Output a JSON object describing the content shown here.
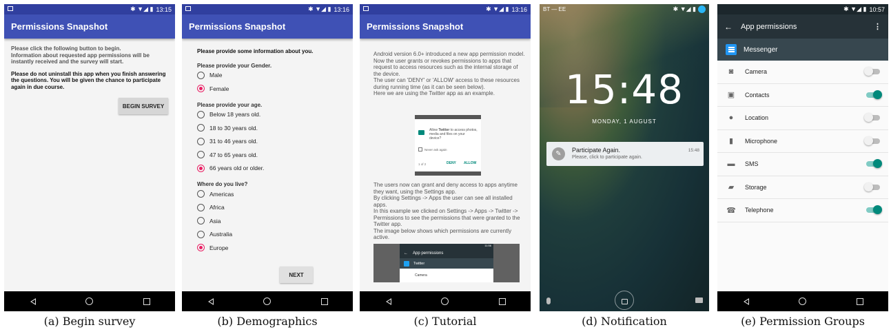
{
  "common": {
    "app_title": "Permissions Snapshot"
  },
  "panel_a": {
    "time": "13:15",
    "instruction1": "Please click the following button to begin.",
    "instruction2": "Information about requested app permissions will be instantly received and the survey will start.",
    "instruction3": "Please do not uninstall this app when you finish answering the questions. You will be given the chance to participate again in due course.",
    "begin_button": "BEGIN SURVEY",
    "caption": "(a) Begin survey"
  },
  "panel_b": {
    "time": "13:16",
    "intro": "Please provide some information about you.",
    "gender_q": "Please provide your Gender.",
    "gender_options": [
      {
        "label": "Male",
        "selected": false
      },
      {
        "label": "Female",
        "selected": true
      }
    ],
    "age_q": "Please provide your age.",
    "age_options": [
      {
        "label": "Below 18 years old.",
        "selected": false
      },
      {
        "label": "18 to 30 years old.",
        "selected": false
      },
      {
        "label": "31 to 46 years old.",
        "selected": false
      },
      {
        "label": "47 to 65 years old.",
        "selected": false
      },
      {
        "label": "66 years old or older.",
        "selected": true
      }
    ],
    "location_q": "Where do you live?",
    "location_options": [
      {
        "label": "Americas",
        "selected": false
      },
      {
        "label": "Africa",
        "selected": false
      },
      {
        "label": "Asia",
        "selected": false
      },
      {
        "label": "Australia",
        "selected": false
      },
      {
        "label": "Europe",
        "selected": true
      }
    ],
    "next_button": "NEXT",
    "caption": "(b) Demographics"
  },
  "panel_c": {
    "time": "13:16",
    "para1": "Android version 6.0+ introduced a new app permission model.\nNow the user grants or revokes permissions to apps that request to access resources such as the internal storage of the device.\nThe user can 'DENY' or 'ALLOW' access to these resources during running time (as it can be seen below).\nHere we are using the Twitter app as an example.",
    "dialog_text_pre": "Allow ",
    "dialog_app": "Twitter",
    "dialog_text_post": " to access photos, media and files on your device?",
    "never_ask": "Never ask again",
    "page_count": "1 of 2",
    "deny": "DENY",
    "allow": "ALLOW",
    "para2": "The users now can grant and deny access to apps anytime they want, using the Settings app.\nBy clicking Settings -> Apps the user can see all installed apps.\nIn this example we clicked on Settings -> Apps -> Twitter -> Permissions to see the permissions that were granted to the Twitter app.\nThe image below shows which permissions are currently active.",
    "mini_time": "11:56",
    "mini_title": "App permissions",
    "mini_app": "Twitter",
    "mini_row": "Camera",
    "caption": "(c) Tutorial"
  },
  "panel_d": {
    "carrier": "BT — EE",
    "clock": "15:48",
    "date": "MONDAY, 1 AUGUST",
    "notif_title": "Participate Again.",
    "notif_body": "Please, click to participate again.",
    "notif_time": "15:48",
    "caption": "(d) Notification"
  },
  "panel_e": {
    "time": "10:57",
    "title": "App permissions",
    "app_name": "Messenger",
    "permissions": [
      {
        "label": "Camera",
        "on": false,
        "icon": "camera-icon"
      },
      {
        "label": "Contacts",
        "on": true,
        "icon": "contacts-icon"
      },
      {
        "label": "Location",
        "on": false,
        "icon": "location-icon"
      },
      {
        "label": "Microphone",
        "on": false,
        "icon": "microphone-icon"
      },
      {
        "label": "SMS",
        "on": true,
        "icon": "sms-icon"
      },
      {
        "label": "Storage",
        "on": false,
        "icon": "storage-icon"
      },
      {
        "label": "Telephone",
        "on": true,
        "icon": "telephone-icon"
      }
    ],
    "caption": "(e) Permission Groups"
  },
  "colors": {
    "app_bar": "#3f51b5",
    "radio_selected": "#e91e63",
    "toggle_on": "#00897b",
    "settings_bar": "#263238"
  }
}
